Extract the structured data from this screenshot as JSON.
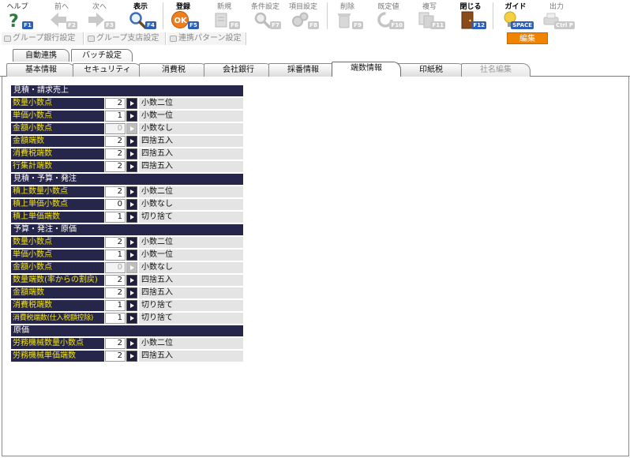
{
  "toolbar": {
    "buttons": [
      {
        "label": "ヘルプ",
        "key": "F1",
        "icon": "help-icon"
      },
      {
        "label": "前へ",
        "key": "F2",
        "icon": "arrow-left-icon"
      },
      {
        "label": "次へ",
        "key": "F3",
        "icon": "arrow-right-icon"
      },
      {
        "label": "表示",
        "key": "F4",
        "icon": "search-icon"
      },
      {
        "label": "登録",
        "key": "F5",
        "icon": "ok-icon"
      },
      {
        "label": "新規",
        "key": "F6",
        "icon": "new-document-icon"
      },
      {
        "label": "条件設定",
        "key": "F7",
        "icon": "filter-search-icon"
      },
      {
        "label": "項目設定",
        "key": "F8",
        "icon": "settings-gears-icon"
      },
      {
        "label": "削除",
        "key": "F9",
        "icon": "trash-icon"
      },
      {
        "label": "既定値",
        "key": "F10",
        "icon": "reset-icon"
      },
      {
        "label": "複写",
        "key": "F11",
        "icon": "copy-icon"
      },
      {
        "label": "閉じる",
        "key": "F12",
        "icon": "door-close-icon"
      },
      {
        "label": "ガイド",
        "key": "SPACE",
        "icon": "lightbulb-icon"
      },
      {
        "label": "出力",
        "key": "Ctrl P",
        "icon": "printer-icon"
      }
    ]
  },
  "subbar": {
    "items": [
      "グループ銀行設定",
      "グループ支店設定",
      "連携パターン設定"
    ],
    "edit_badge": "編集"
  },
  "tabs_top": [
    "自動連携",
    "バッチ設定"
  ],
  "tabs": [
    "基本情報",
    "セキュリティ",
    "消費税",
    "会社銀行",
    "採番情報",
    "端数情報",
    "印紙税",
    "社名編集"
  ],
  "active_tab": "端数情報",
  "sections": [
    {
      "title": "見積・請求売上",
      "rows": [
        {
          "label": "数量小数点",
          "value": "2",
          "desc": "小数二位",
          "disabled": false
        },
        {
          "label": "単価小数点",
          "value": "1",
          "desc": "小数一位",
          "disabled": false
        },
        {
          "label": "金額小数点",
          "value": "0",
          "desc": "小数なし",
          "disabled": true
        },
        {
          "label": "金額端数",
          "value": "2",
          "desc": "四捨五入",
          "disabled": false
        },
        {
          "label": "消費税端数",
          "value": "2",
          "desc": "四捨五入",
          "disabled": false
        },
        {
          "label": "行集計端数",
          "value": "2",
          "desc": "四捨五入",
          "disabled": false
        }
      ]
    },
    {
      "title": "見積・予算・発注",
      "rows": [
        {
          "label": "積上数量小数点",
          "value": "2",
          "desc": "小数二位",
          "disabled": false
        },
        {
          "label": "積上単価小数点",
          "value": "0",
          "desc": "小数なし",
          "disabled": false
        },
        {
          "label": "積上単価端数",
          "value": "1",
          "desc": "切り捨て",
          "disabled": false
        }
      ]
    },
    {
      "title": "予算・発注・原価",
      "rows": [
        {
          "label": "数量小数点",
          "value": "2",
          "desc": "小数二位",
          "disabled": false
        },
        {
          "label": "単価小数点",
          "value": "1",
          "desc": "小数一位",
          "disabled": false
        },
        {
          "label": "金額小数点",
          "value": "0",
          "desc": "小数なし",
          "disabled": true
        },
        {
          "label": "数量端数(率からの割戻)",
          "value": "2",
          "desc": "四捨五入",
          "disabled": false
        },
        {
          "label": "金額端数",
          "value": "2",
          "desc": "四捨五入",
          "disabled": false
        },
        {
          "label": "消費税端数",
          "value": "1",
          "desc": "切り捨て",
          "disabled": false
        },
        {
          "label": "消費税端数(仕入税額控除)",
          "value": "1",
          "desc": "切り捨て",
          "disabled": false
        }
      ]
    },
    {
      "title": "原価",
      "rows": [
        {
          "label": "労務機械数量小数点",
          "value": "2",
          "desc": "小数二位",
          "disabled": false
        },
        {
          "label": "労務機械単価端数",
          "value": "2",
          "desc": "四捨五入",
          "disabled": false
        }
      ]
    }
  ]
}
